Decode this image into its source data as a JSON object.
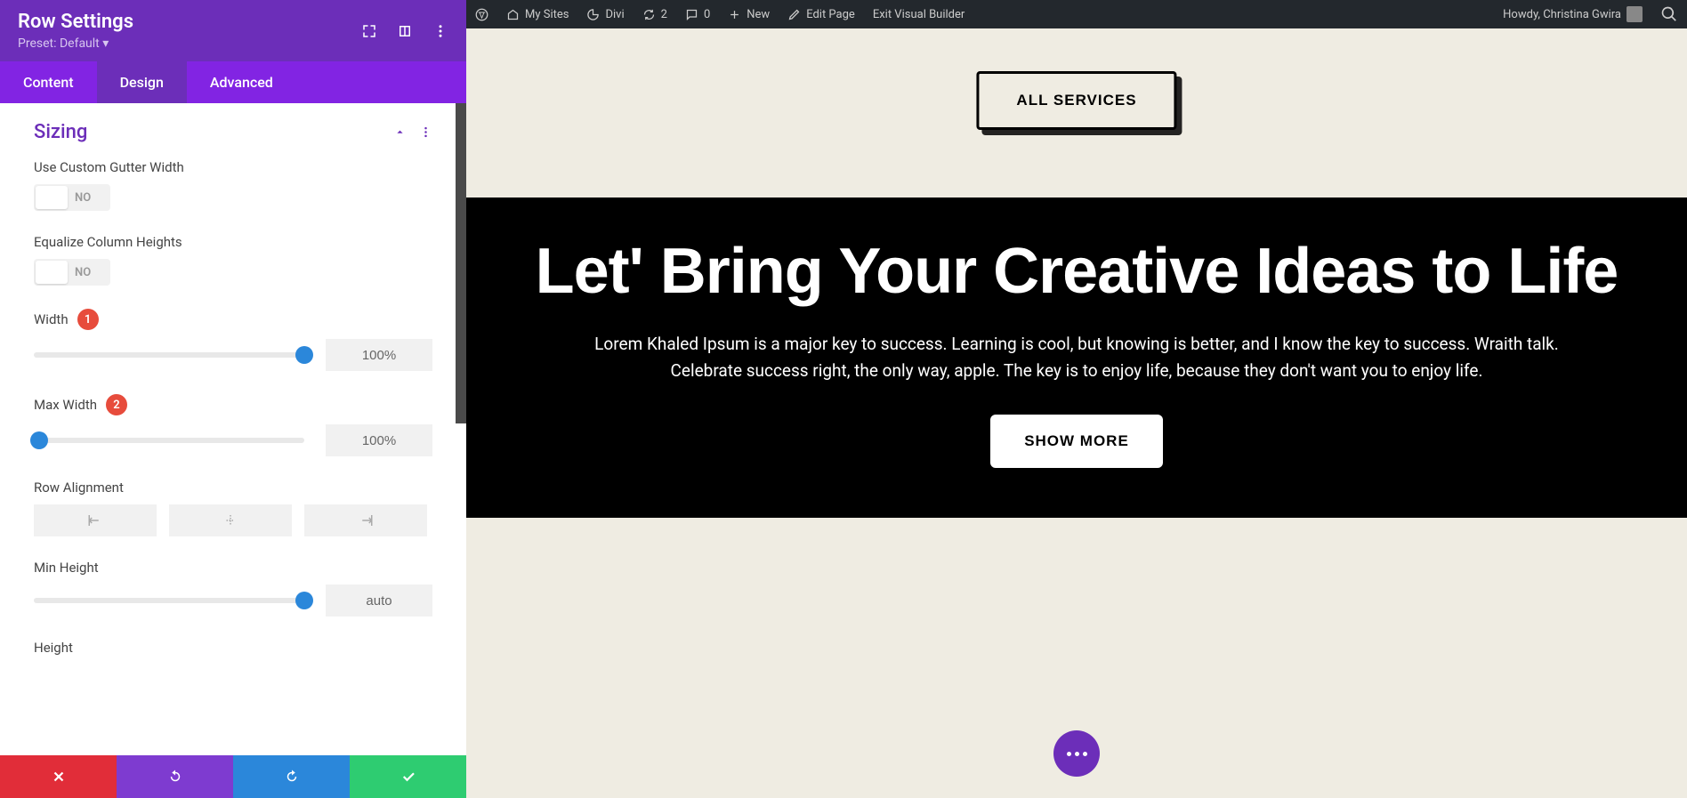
{
  "adminbar": {
    "my_sites": "My Sites",
    "divi": "Divi",
    "updates": "2",
    "comments": "0",
    "new": "New",
    "edit_page": "Edit Page",
    "exit_vb": "Exit Visual Builder",
    "howdy": "Howdy, Christina Gwira"
  },
  "sidebar": {
    "title": "Row Settings",
    "preset": "Preset: Default ▾",
    "tabs": {
      "content": "Content",
      "design": "Design",
      "advanced": "Advanced"
    },
    "section": "Sizing",
    "gutter_label": "Use Custom Gutter Width",
    "gutter_val": "NO",
    "equalize_label": "Equalize Column Heights",
    "equalize_val": "NO",
    "width_label": "Width",
    "width_val": "100%",
    "maxwidth_label": "Max Width",
    "maxwidth_val": "100%",
    "rowalign_label": "Row Alignment",
    "minheight_label": "Min Height",
    "minheight_val": "auto",
    "height_label": "Height",
    "badge1": "1",
    "badge2": "2"
  },
  "preview": {
    "all_services": "ALL SERVICES",
    "heading": "Let' Bring Your Creative Ideas to Life",
    "paragraph": "Lorem Khaled Ipsum is a major key to success. Learning is cool, but knowing is better, and I know the key to success. Wraith talk. Celebrate success right, the only way, apple. The key is to enjoy life, because they don't want you to enjoy life.",
    "show_more": "SHOW MORE"
  },
  "colors": {
    "purple": "#6c2eb9",
    "purple_light": "#8224e3",
    "blue": "#2b87da",
    "red": "#e12d39",
    "green": "#2ecc71",
    "beige": "#efece2"
  }
}
